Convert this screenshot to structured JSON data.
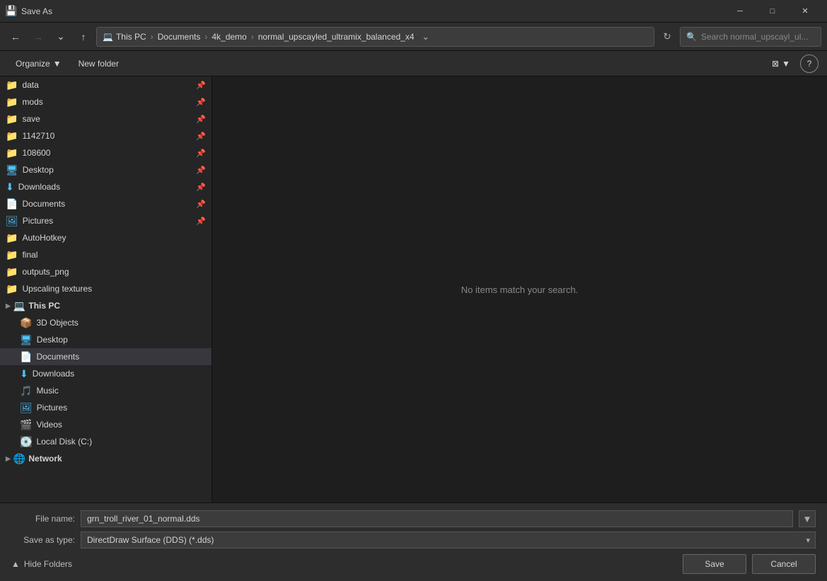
{
  "titleBar": {
    "icon": "💾",
    "title": "Save As",
    "minimizeLabel": "─",
    "maximizeLabel": "□",
    "closeLabel": "✕"
  },
  "addressBar": {
    "backLabel": "←",
    "forwardLabel": "→",
    "dropdownLabel": "▾",
    "upLabel": "↑",
    "pathParts": [
      "This PC",
      "Documents",
      "4k_demo",
      "normal_upscayled_ultramix_balanced_x4"
    ],
    "dropdownArrow": "▾",
    "refreshLabel": "⟳",
    "searchPlaceholder": "Search normal_upscayl_ul...",
    "searchIcon": "🔍"
  },
  "toolbar": {
    "organizeLabel": "Organize",
    "organizeArrow": "▾",
    "newFolderLabel": "New folder",
    "viewIcon": "⊞",
    "viewArrow": "▾",
    "helpLabel": "?"
  },
  "sidebar": {
    "quickAccess": [
      {
        "name": "data",
        "icon": "📁",
        "color": "yellow",
        "pinned": true,
        "indent": 0
      },
      {
        "name": "mods",
        "icon": "📁",
        "color": "yellow",
        "pinned": true,
        "indent": 0
      },
      {
        "name": "save",
        "icon": "📁",
        "color": "yellow",
        "pinned": true,
        "indent": 0
      },
      {
        "name": "1142710",
        "icon": "📁",
        "color": "yellow",
        "pinned": true,
        "indent": 0
      },
      {
        "name": "108600",
        "icon": "📁",
        "color": "yellow",
        "pinned": true,
        "indent": 0
      },
      {
        "name": "Desktop",
        "icon": "🖥",
        "color": "blue",
        "pinned": true,
        "indent": 0
      },
      {
        "name": "Downloads",
        "icon": "⬇",
        "color": "blue",
        "pinned": true,
        "indent": 0
      },
      {
        "name": "Documents",
        "icon": "📄",
        "color": "blue",
        "pinned": true,
        "indent": 0
      },
      {
        "name": "Pictures",
        "icon": "🖼",
        "color": "blue",
        "pinned": true,
        "indent": 0
      },
      {
        "name": "AutoHotkey",
        "icon": "📁",
        "color": "yellow",
        "pinned": false,
        "indent": 0
      },
      {
        "name": "final",
        "icon": "📁",
        "color": "yellow",
        "pinned": false,
        "indent": 0
      },
      {
        "name": "outputs_png",
        "icon": "📁",
        "color": "yellow",
        "pinned": false,
        "indent": 0
      },
      {
        "name": "Upscaling textures",
        "icon": "📁",
        "color": "yellow",
        "pinned": false,
        "indent": 0
      }
    ],
    "thisPC": {
      "label": "This PC",
      "icon": "💻",
      "items": [
        {
          "name": "3D Objects",
          "icon": "📦",
          "color": "blue"
        },
        {
          "name": "Desktop",
          "icon": "🖥",
          "color": "blue"
        },
        {
          "name": "Documents",
          "icon": "📄",
          "color": "blue",
          "selected": true
        },
        {
          "name": "Downloads",
          "icon": "⬇",
          "color": "blue"
        },
        {
          "name": "Music",
          "icon": "🎵",
          "color": "blue"
        },
        {
          "name": "Pictures",
          "icon": "🖼",
          "color": "blue"
        },
        {
          "name": "Videos",
          "icon": "🎬",
          "color": "blue"
        },
        {
          "name": "Local Disk (C:)",
          "icon": "💽",
          "color": "blue"
        }
      ]
    },
    "network": {
      "label": "Network",
      "icon": "🌐"
    }
  },
  "content": {
    "emptyMessage": "No items match your search."
  },
  "fileNameRow": {
    "label": "File name:",
    "value": "grn_troll_river_01_normal.dds"
  },
  "fileTypeRow": {
    "label": "Save as type:",
    "value": "DirectDraw Surface (DDS) (*.dds)"
  },
  "footer": {
    "hideFoldersChevron": "▲",
    "hideFoldersLabel": "Hide Folders",
    "saveLabel": "Save",
    "cancelLabel": "Cancel"
  }
}
